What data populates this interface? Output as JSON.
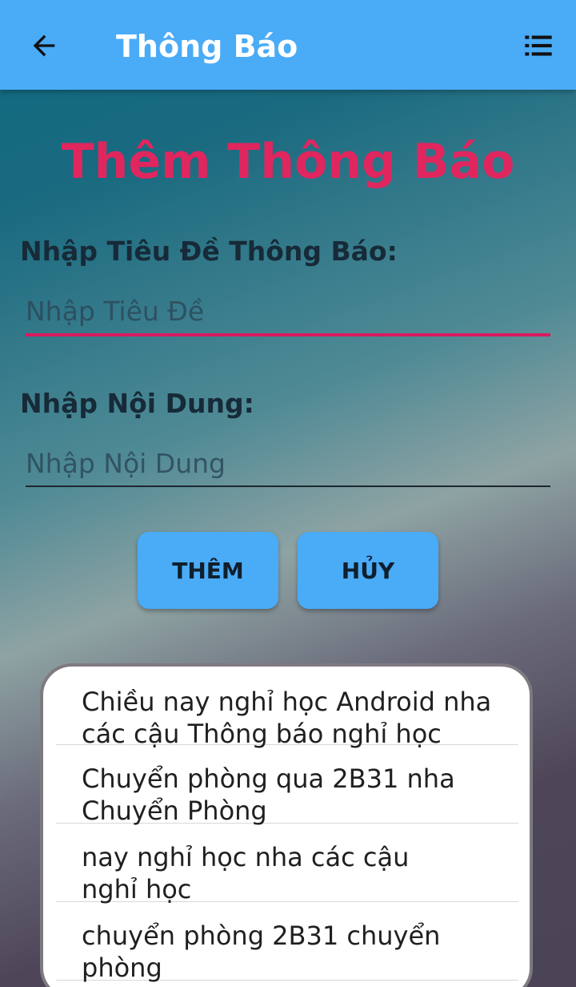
{
  "appbar": {
    "title": "Thông Báo",
    "back_icon": "arrow-left-icon",
    "menu_icon": "list-menu-icon"
  },
  "form": {
    "heading": "Thêm Thông Báo",
    "title_label": "Nhập Tiêu Đề Thông Báo:",
    "title_placeholder": "Nhập Tiêu Đề",
    "content_label": "Nhập Nội Dung:",
    "content_placeholder": "Nhập Nội Dung",
    "add_button": "THÊM",
    "cancel_button": "HỦY"
  },
  "notifications": [
    {
      "line1": "Chiều nay nghỉ học Android nha",
      "line2": "các cậu   Thông báo nghỉ học"
    },
    {
      "line1": "Chuyển phòng qua 2B31 nha",
      "line2": "Chuyển Phòng"
    },
    {
      "line1": "nay nghỉ học nha các cậu",
      "line2": "nghỉ học"
    },
    {
      "line1": "chuyển phòng 2B31   chuyển",
      "line2": "phòng"
    }
  ],
  "colors": {
    "appbar": "#4aabf7",
    "heading": "#e0265f",
    "focused_underline": "#d81b60"
  }
}
